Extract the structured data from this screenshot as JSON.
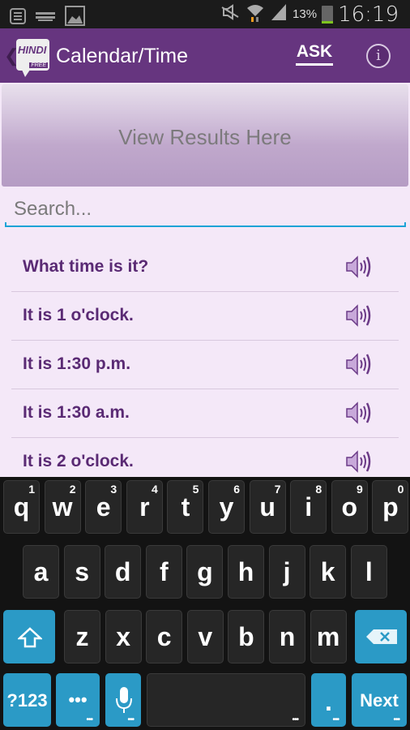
{
  "status_bar": {
    "left_icons": [
      "notes-icon",
      "keyboard-icon",
      "image-icon"
    ],
    "right_icons": [
      "mute-icon",
      "wifi-icon",
      "signal-icon"
    ],
    "battery_percent": "13%",
    "time": "16:19"
  },
  "action_bar": {
    "logo_text": "HINDI",
    "logo_badge": "FREE",
    "title": "Calendar/Time",
    "ask_label": "ASK",
    "info_label": "i",
    "accent_color": "#66357f"
  },
  "results": {
    "placeholder": "View Results Here"
  },
  "search": {
    "placeholder": "Search...",
    "value": ""
  },
  "phrases": [
    {
      "text": "What time is it?"
    },
    {
      "text": "It is 1 o'clock."
    },
    {
      "text": "It is 1:30 p.m."
    },
    {
      "text": "It is 1:30 a.m."
    },
    {
      "text": "It is 2 o'clock."
    }
  ],
  "keyboard": {
    "row1": [
      {
        "k": "q",
        "h": "1"
      },
      {
        "k": "w",
        "h": "2"
      },
      {
        "k": "e",
        "h": "3"
      },
      {
        "k": "r",
        "h": "4"
      },
      {
        "k": "t",
        "h": "5"
      },
      {
        "k": "y",
        "h": "6"
      },
      {
        "k": "u",
        "h": "7"
      },
      {
        "k": "i",
        "h": "8"
      },
      {
        "k": "o",
        "h": "9"
      },
      {
        "k": "p",
        "h": "0"
      }
    ],
    "row2": [
      "a",
      "s",
      "d",
      "f",
      "g",
      "h",
      "j",
      "k",
      "l"
    ],
    "row3": [
      "z",
      "x",
      "c",
      "v",
      "b",
      "n",
      "m"
    ],
    "symbols_label": "?123",
    "more_label": "•••",
    "period_label": ".",
    "next_label": "Next"
  }
}
